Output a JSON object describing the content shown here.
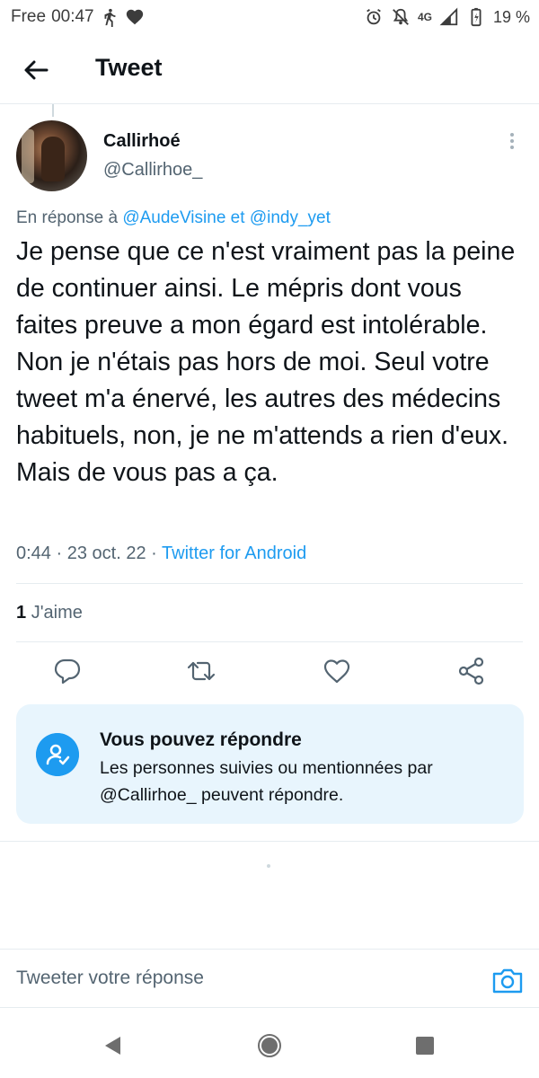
{
  "status_bar": {
    "carrier": "Free",
    "time": "00:47",
    "network": "4G",
    "battery": "19 %"
  },
  "header": {
    "title": "Tweet"
  },
  "tweet": {
    "author_name": "Callirhoé",
    "author_handle": "@Callirhoe_",
    "reply_prefix": "En réponse à",
    "reply_mention_1": "@AudeVisine",
    "reply_conjunction": "et",
    "reply_mention_2": "@indy_yet",
    "text": "Je pense que ce n'est vraiment pas la peine de continuer ainsi. Le mépris dont vous faites preuve a mon égard est intolérable. Non je n'étais pas hors de moi. Seul votre tweet m'a énervé, les autres des médecins habituels, non, je ne m'attends a rien d'eux. Mais de vous pas a ça.",
    "time": "0:44",
    "date": "23 oct. 22",
    "separator": "·",
    "source": "Twitter for Android",
    "likes_count": "1",
    "likes_label": "J'aime"
  },
  "actions": {
    "reply_icon": "reply-icon",
    "retweet_icon": "retweet-icon",
    "like_icon": "heart-icon",
    "share_icon": "share-icon"
  },
  "reply_card": {
    "title": "Vous pouvez répondre",
    "body": "Les personnes suivies ou mentionnées par @Callirhoe_  peuvent répondre."
  },
  "composer": {
    "placeholder": "Tweeter votre réponse"
  },
  "colors": {
    "accent": "#1d9bf0",
    "text": "#0f1419",
    "secondary": "#536471",
    "card_bg": "#e8f5fd"
  }
}
